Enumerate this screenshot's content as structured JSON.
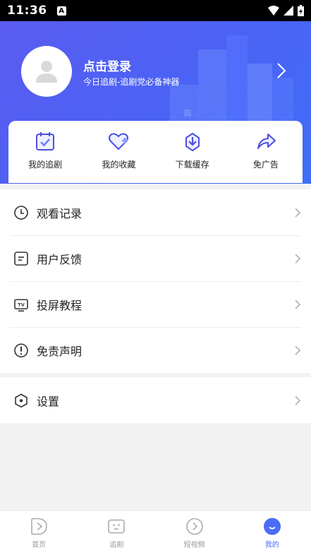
{
  "status_bar": {
    "time": "11:36",
    "badge": "A"
  },
  "profile": {
    "login_title": "点击登录",
    "login_subtitle": "今日追剧-追剧党必备神器"
  },
  "quick_actions": [
    {
      "label": "我的追剧",
      "icon": "calendar-check-icon"
    },
    {
      "label": "我的收藏",
      "icon": "heart-plus-icon"
    },
    {
      "label": "下载缓存",
      "icon": "download-icon"
    },
    {
      "label": "免广告",
      "icon": "share-arrow-icon"
    }
  ],
  "menu": [
    {
      "label": "观看记录",
      "icon": "clock-icon"
    },
    {
      "label": "用户反馈",
      "icon": "feedback-icon"
    },
    {
      "label": "投屏教程",
      "icon": "tv-icon"
    },
    {
      "label": "免责声明",
      "icon": "exclamation-icon"
    }
  ],
  "settings": {
    "label": "设置",
    "icon": "hexagon-settings-icon"
  },
  "tabs": [
    {
      "label": "首页",
      "icon": "play-icon"
    },
    {
      "label": "追剧",
      "icon": "tv-face-icon"
    },
    {
      "label": "短视频",
      "icon": "chevron-circle-icon"
    },
    {
      "label": "我的",
      "icon": "smile-icon"
    }
  ],
  "colors": {
    "accent": "#4b6cf6",
    "hero_start": "#5a5cf0",
    "hero_end": "#3f6ef7"
  }
}
